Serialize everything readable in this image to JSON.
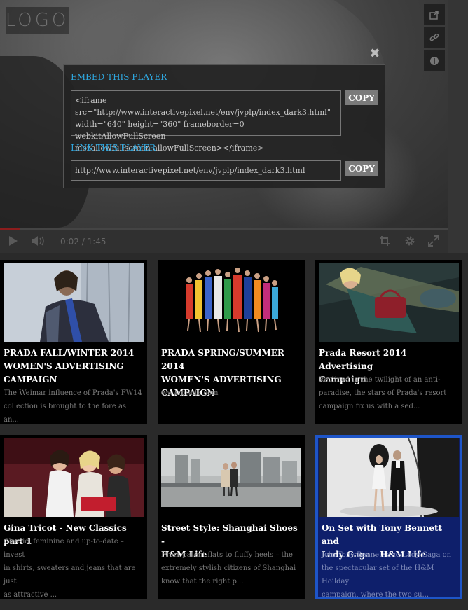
{
  "player": {
    "logo_text": "LOGO",
    "time_display": "0:02 / 1:45",
    "progress_fraction": 0.045,
    "side_icons": [
      "share-icon",
      "link-icon",
      "info-icon"
    ],
    "controls": [
      "play-icon",
      "volume-icon",
      "crop-icon",
      "gear-icon",
      "fullscreen-icon"
    ]
  },
  "embed_dialog": {
    "embed_heading": "EMBED THIS PLAYER",
    "embed_code_line1": "<iframe src=\"http://www.interactivepixel.net/env/jvplp/index_dark3.html\"",
    "embed_code_line2": "width=\"640\" height=\"360\" frameborder=0 webkitAllowFullScreen",
    "embed_code_line3": "mozallowfullscreen allowFullScreen></iframe>",
    "embed_copy_label": "COPY",
    "link_heading": "LINK THIS PLAYER",
    "link_url": "http://www.interactivepixel.net/env/jvplp/index_dark3.html",
    "link_copy_label": "COPY"
  },
  "colors": {
    "accent": "#2fa8e0",
    "selected_border": "#1e55c8",
    "selected_bg": "#0e1f6b"
  },
  "playlist": [
    {
      "title_lines": [
        "PRADA FALL/WINTER 2014",
        "WOMEN'S ADVERTISING",
        "CAMPAIGN"
      ],
      "desc_lines": [
        "The Weimar influence of Prada's FW14",
        "collection is brought to the fore as an..."
      ],
      "selected": false
    },
    {
      "title_lines": [
        "PRADA SPRING/SUMMER 2014",
        "WOMEN'S ADVERTISING",
        "CAMPAIGN"
      ],
      "desc_lines": [
        "www.prada.com"
      ],
      "selected": false
    },
    {
      "title_lines": [
        "Prada Resort 2014 Advertising",
        "Campaign"
      ],
      "desc_lines": [
        "Reclined in the twilight of an anti-",
        "paradise, the stars of Prada's resort",
        "campaign fix us with a sed..."
      ],
      "selected": false
    },
    {
      "title_lines": [
        "Gina Tricot - New Classics part 1"
      ],
      "desc_lines": [
        "Classic, feminine and up-to-date – invest",
        "in shirts, sweaters and jeans that are just",
        "as attractive ..."
      ],
      "selected": false
    },
    {
      "title_lines": [
        "Street Style: Shanghai Shoes -",
        "H&M Life"
      ],
      "desc_lines": [
        "From patent flats to fluffy heels – the",
        "extremely stylish citizens of Shanghai",
        "know that the right p..."
      ],
      "selected": false
    },
    {
      "title_lines": [
        "On Set with Tony Bennett and",
        "Lady Gaga - H&M Life"
      ],
      "desc_lines": [
        "Join Tony Bennett and Lady Gaga on",
        "the spectacular set of the H&M Hoilday",
        "campaign, where the two su..."
      ],
      "selected": true
    }
  ]
}
